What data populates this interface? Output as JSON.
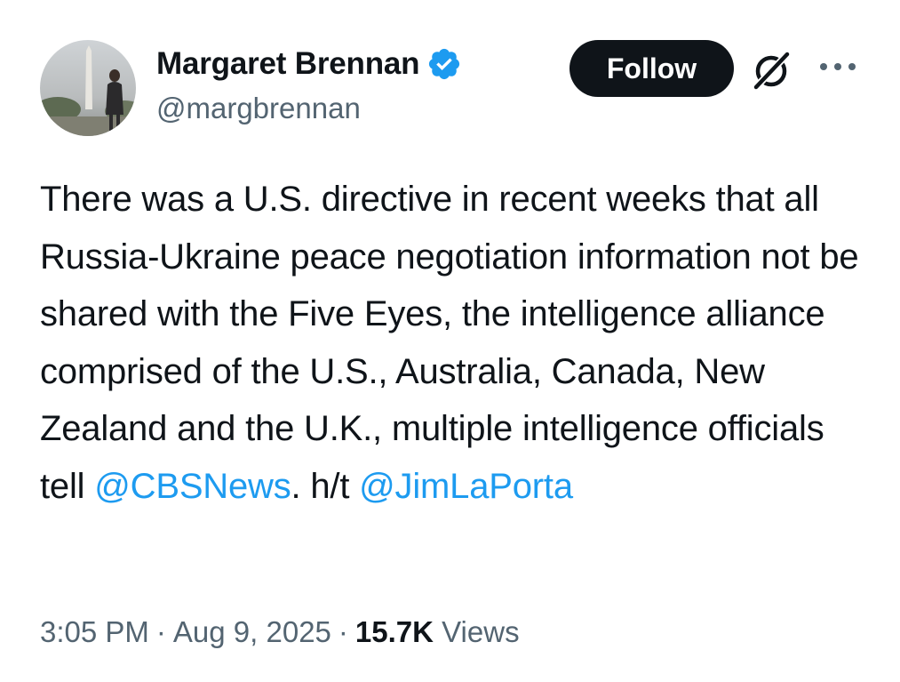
{
  "author": {
    "display_name": "Margaret Brennan",
    "handle": "@margbrennan",
    "verified_icon": "verified-badge-icon",
    "verified_color": "#1d9bf0"
  },
  "actions": {
    "follow_label": "Follow",
    "grok_icon": "grok-icon",
    "more_icon": "more-options-icon"
  },
  "tweet": {
    "text_before": "There was a U.S. directive in recent weeks that all Russia-Ukraine peace negotiation information not be shared with the Five Eyes, the intelligence alliance comprised of the U.S., Australia, Canada, New Zealand and the U.K., multiple intelligence officials tell ",
    "mention_1": "@CBSNews",
    "text_middle": ". h/t ",
    "mention_2": "@JimLaPorta",
    "mention_color": "#1d9bf0"
  },
  "meta": {
    "time": "3:05 PM",
    "separator": "·",
    "date": "Aug 9, 2025",
    "views_count": "15.7K",
    "views_label": "Views"
  }
}
